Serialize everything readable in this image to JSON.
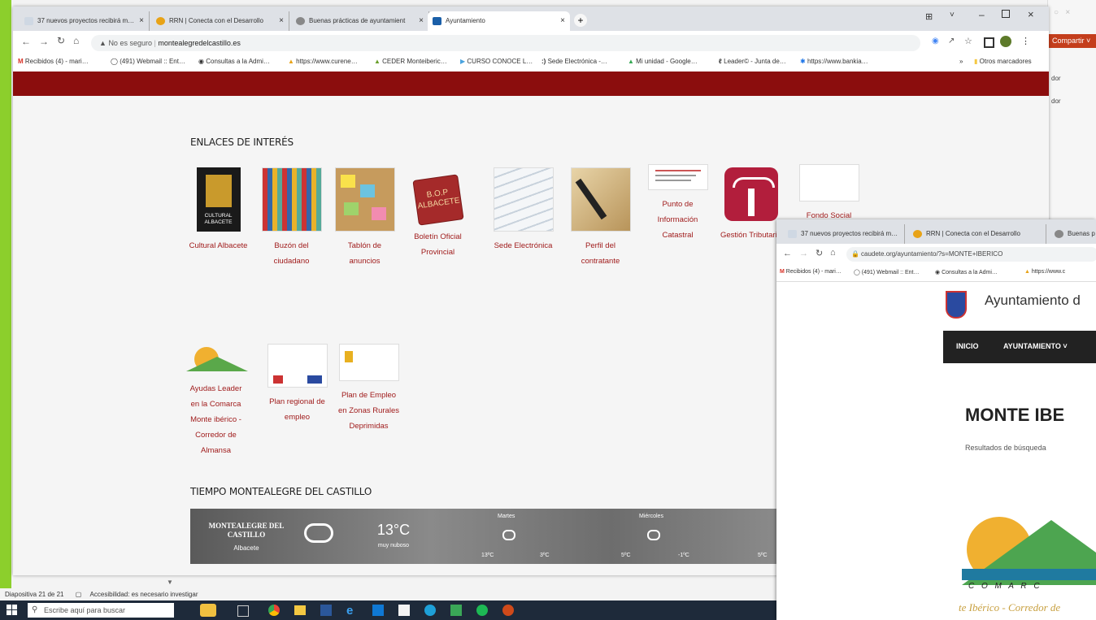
{
  "browser_main": {
    "tabs": [
      {
        "label": "37 nuevos proyectos recibirá m…",
        "close": "×"
      },
      {
        "label": "RRN | Conecta con el Desarrollo",
        "close": "×"
      },
      {
        "label": "Buenas prácticas de ayuntamient",
        "close": "×"
      },
      {
        "label": "Ayuntamiento",
        "close": "×"
      }
    ],
    "new_tab": "+",
    "security": "No es seguro",
    "url": "montealegredelcastillo.es",
    "bookmarks": [
      "Recibidos (4) - mari…",
      "(491) Webmail :: Ent…",
      "Consultas a la Admi…",
      "https://www.curene…",
      "CEDER Monteiberic…",
      "CURSO CONOCE L…",
      "Sede Electrónica -…",
      "Mi unidad - Google…",
      "Leader© - Junta de…",
      "https://www.bankia…"
    ],
    "bookmarks_more": "»",
    "other_bookmarks": "Otros marcadores"
  },
  "page": {
    "links_heading": "ENLACES DE INTERÉS",
    "links_row1": [
      {
        "label": "Cultural Albacete",
        "img_text": "CULTURAL ALBACETE"
      },
      {
        "label": "Buzón del ciudadano"
      },
      {
        "label": "Tablón de anuncios"
      },
      {
        "label": "Boletín Oficial Provincial",
        "img_text": "B.O.P ALBACETE"
      },
      {
        "label": "Sede Electrónica"
      },
      {
        "label": "Perfil del contratante"
      },
      {
        "label": "Punto de Información Catastral"
      },
      {
        "label": "Gestión Tributaria"
      },
      {
        "label": "Fondo Social"
      }
    ],
    "links_row2": [
      {
        "label": "Ayudas Leader en la Comarca Monte ibérico - Corredor de Almansa"
      },
      {
        "label": "Plan regional de empleo"
      },
      {
        "label": "Plan de Empleo en Zonas Rurales Deprimidas"
      }
    ],
    "weather_heading": "TIEMPO MONTEALEGRE DEL CASTILLO",
    "weather": {
      "place": "MONTEALEGRE DEL CASTILLO",
      "region": "Albacete",
      "temp": "13°C",
      "desc": "muy nuboso",
      "day1": "Martes",
      "day2": "Miércoles",
      "t1": "13ºC",
      "t2": "3ºC",
      "t3": "5ºC",
      "t4": "-1ºC",
      "t5": "5ºC"
    }
  },
  "browser_second": {
    "tabs": [
      "37 nuevos proyectos recibirá m…",
      "RRN | Conecta con el Desarrollo",
      "Buenas p"
    ],
    "url": "caudete.org/ayuntamiento/?s=MONTE+IBERICO",
    "bookmarks": [
      "Recibidos (4) - mari…",
      "(491) Webmail :: Ent…",
      "Consultas a la Admi…",
      "https://www.c"
    ],
    "site_title": "Ayuntamiento d",
    "nav": [
      "INICIO",
      "AYUNTAMIENTO ˅"
    ],
    "search_heading": "MONTE IBE",
    "search_subtitle": "Resultados de búsqueda",
    "logo_letters": "C  O  M  A  R  C",
    "logo_script": "te Ibérico - Corredor de"
  },
  "powerpoint": {
    "share": "Compartir ˅",
    "status_slide": "Diapositiva 21 de 21",
    "status_access": "Accesibilidad: es necesario investigar",
    "side_labels": [
      "dor",
      "dor"
    ]
  },
  "taskbar": {
    "search_placeholder": "Escribe aquí para buscar"
  },
  "colors": {
    "accent_red": "#8b0d0d",
    "link_red": "#a01c1c",
    "slide_green": "#8ccf2c"
  }
}
